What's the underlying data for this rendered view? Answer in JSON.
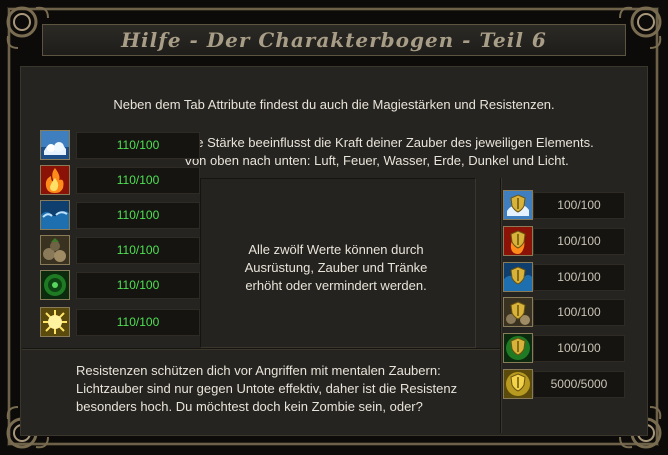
{
  "window": {
    "title": "Hilfe - Der Charakterbogen - Teil 6"
  },
  "texts": {
    "intro": "Neben dem Tab Attribute findest du auch die Magiestärken und Resistenzen.",
    "strength_line1": "Die Stärke beeinflusst die Kraft deiner Zauber des jeweiligen Elements.",
    "strength_line2": "Von oben nach unten: Luft, Feuer, Wasser, Erde, Dunkel und Licht.",
    "center_line1": "Alle zwölf Werte können durch",
    "center_line2": "Ausrüstung, Zauber und Tränke",
    "center_line3": "erhöht oder vermindert werden.",
    "resist_line1": "Resistenzen schützen dich vor Angriffen mit mentalen Zaubern:",
    "resist_line2": "Lichtzauber sind nur gegen Untote effektiv, daher ist die Resistenz",
    "resist_line3": "besonders hoch. Du möchtest doch kein Zombie sein, oder?"
  },
  "magic_strengths": [
    {
      "element": "air-icon",
      "value": "110/100"
    },
    {
      "element": "fire-icon",
      "value": "110/100"
    },
    {
      "element": "water-icon",
      "value": "110/100"
    },
    {
      "element": "earth-icon",
      "value": "110/100"
    },
    {
      "element": "dark-icon",
      "value": "110/100"
    },
    {
      "element": "light-icon",
      "value": "110/100"
    }
  ],
  "resistances": [
    {
      "element": "air-resistance-icon",
      "value": "100/100"
    },
    {
      "element": "fire-resistance-icon",
      "value": "100/100"
    },
    {
      "element": "water-resistance-icon",
      "value": "100/100"
    },
    {
      "element": "earth-resistance-icon",
      "value": "100/100"
    },
    {
      "element": "dark-resistance-icon",
      "value": "100/100"
    },
    {
      "element": "light-resistance-icon",
      "value": "5000/5000"
    }
  ],
  "colors": {
    "strength_value": "#4fe052",
    "resistance_value": "#c9c4b5",
    "panel_bg": "#262420",
    "border_gold": "#8a7b58"
  }
}
